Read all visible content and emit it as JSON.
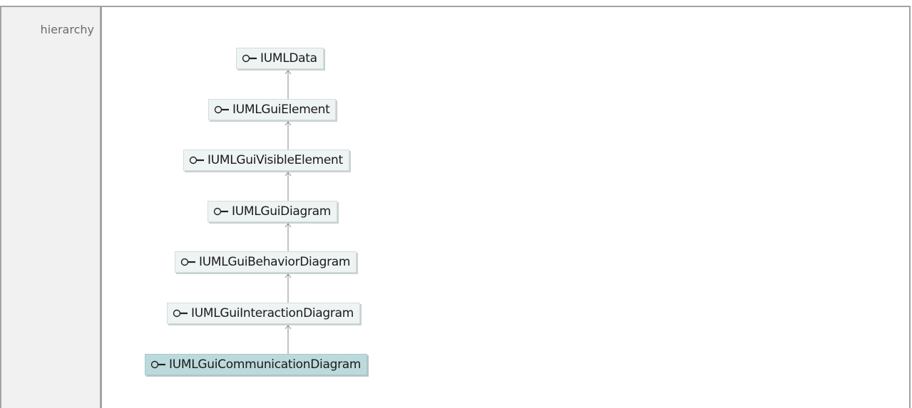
{
  "section": {
    "label": "hierarchy"
  },
  "hierarchy": {
    "nodes": [
      {
        "name": "IUMLData",
        "icon": "interface-icon",
        "selected": false
      },
      {
        "name": "IUMLGuiElement",
        "icon": "interface-icon",
        "selected": false
      },
      {
        "name": "IUMLGuiVisibleElement",
        "icon": "interface-icon",
        "selected": false
      },
      {
        "name": "IUMLGuiDiagram",
        "icon": "interface-icon",
        "selected": false
      },
      {
        "name": "IUMLGuiBehaviorDiagram",
        "icon": "interface-icon",
        "selected": false
      },
      {
        "name": "IUMLGuiInteractionDiagram",
        "icon": "interface-icon",
        "selected": false
      },
      {
        "name": "IUMLGuiCommunicationDiagram",
        "icon": "interface-icon",
        "selected": true
      }
    ]
  }
}
